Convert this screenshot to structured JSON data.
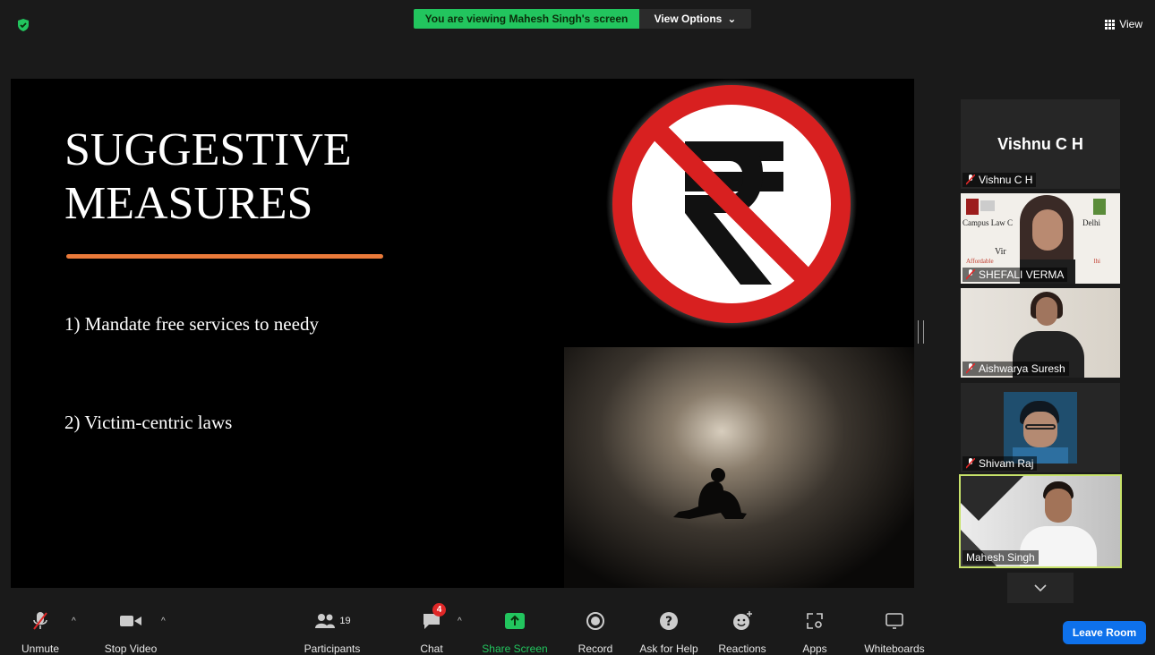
{
  "top": {
    "share_banner": "You are viewing Mahesh Singh's screen",
    "view_options": "View Options",
    "view_label": "View"
  },
  "slide": {
    "title_line1": "SUGGESTIVE",
    "title_line2": "MEASURES",
    "bullets": [
      "1) Mandate free services to needy",
      "2) Victim-centric laws"
    ],
    "accent_color": "#ea7a3a"
  },
  "participants": [
    {
      "display_name": "Vishnu C H",
      "label": "Vishnu C H",
      "muted": true,
      "video": false
    },
    {
      "label": "SHEFALI VERMA",
      "muted": true,
      "video": true,
      "backdrop_text": [
        "Campus Law C",
        "Delhi",
        "Vir",
        "Affordable",
        "lhi"
      ]
    },
    {
      "label": "Aishwarya Suresh",
      "muted": true,
      "video": true
    },
    {
      "label": "Shivam Raj",
      "muted": true,
      "video": true
    },
    {
      "label": "Mahesh Singh",
      "muted": false,
      "video": true,
      "active_speaker": true
    }
  ],
  "toolbar": {
    "unmute": "Unmute",
    "stop_video": "Stop Video",
    "participants": "Participants",
    "participants_count": "19",
    "chat": "Chat",
    "chat_badge": "4",
    "share_screen": "Share Screen",
    "record": "Record",
    "ask_for_help": "Ask for Help",
    "reactions": "Reactions",
    "apps": "Apps",
    "whiteboards": "Whiteboards",
    "leave_room": "Leave Room"
  },
  "colors": {
    "share_green": "#22c55e",
    "leave_blue": "#0e71eb",
    "active_outline": "#c7e26a",
    "mute_red": "#e02828"
  }
}
